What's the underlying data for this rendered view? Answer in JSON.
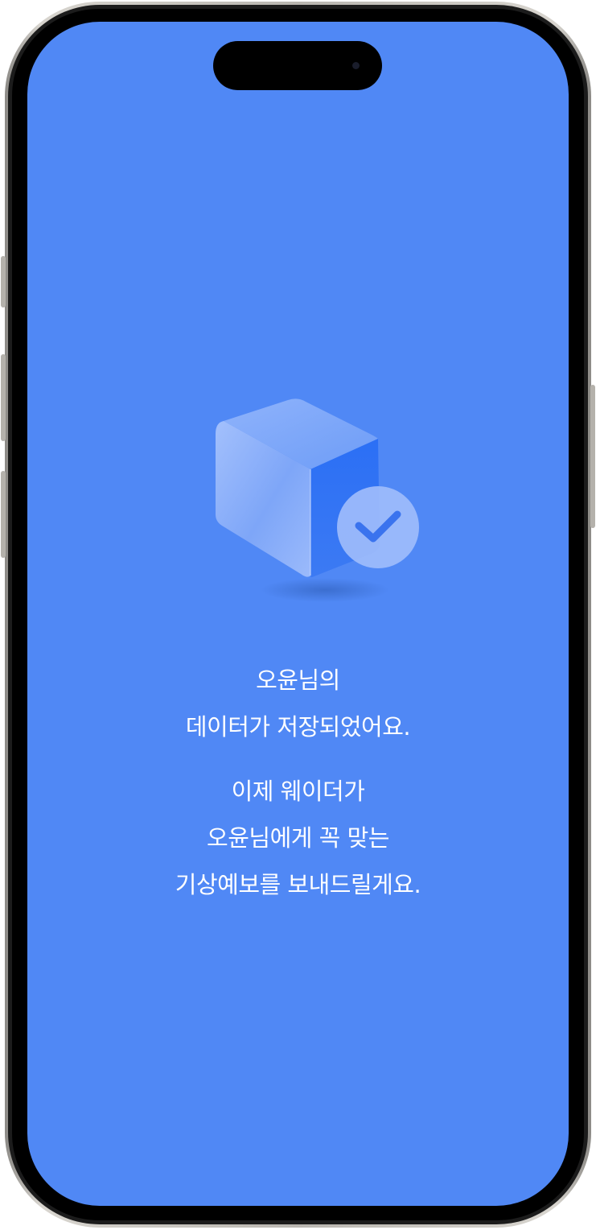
{
  "screen": {
    "background_color": "#5088f5",
    "illustration_icon": "cube-with-check-icon"
  },
  "message": {
    "saved_lines": [
      "오윤님의",
      "데이터가 저장되었어요."
    ],
    "forecast_lines": [
      "이제 웨이더가",
      "오윤님에게 꼭 맞는",
      "기상예보를 보내드릴게요."
    ]
  }
}
